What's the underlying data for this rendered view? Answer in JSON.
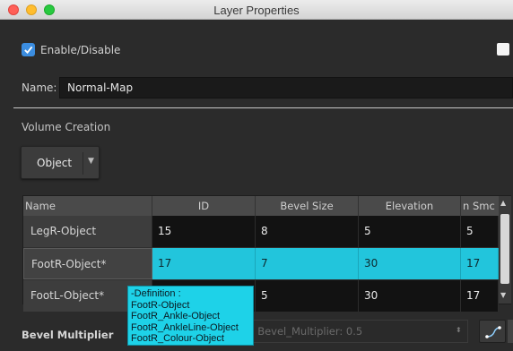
{
  "window": {
    "title": "Layer Properties"
  },
  "enable": {
    "label": "Enable/Disable",
    "checked": true
  },
  "name_field": {
    "label": "Name:",
    "value": "Normal-Map"
  },
  "volume": {
    "section_label": "Volume Creation",
    "dropdown_value": "Object"
  },
  "table": {
    "columns": [
      "Name",
      "ID",
      "Bevel Size",
      "Elevation",
      "n Smc"
    ],
    "rows": [
      {
        "name": "LegR-Object",
        "id": "15",
        "bevel": "8",
        "elevation": "5",
        "smooth": "5"
      },
      {
        "name": "FootR-Object*",
        "id": "17",
        "bevel": "7",
        "elevation": "30",
        "smooth": "17"
      },
      {
        "name": "FootL-Object*",
        "id": "",
        "bevel": "5",
        "elevation": "30",
        "smooth": "17"
      }
    ]
  },
  "tooltip": {
    "lines": [
      "-Definition :",
      "FootR-Object",
      "FootR_Ankle-Object",
      "FootR_AnkleLine-Object",
      "FootR_Colour-Object"
    ]
  },
  "bevel_multiplier": {
    "label": "Bevel Multiplier",
    "field_text": "al-Map: Bevel_Multiplier: 0.5"
  },
  "colors": {
    "selection": "#22c5dc",
    "checkbox": "#3b8de0",
    "tooltip_bg": "#1ed2e8"
  },
  "icons": [
    "checkmark-icon",
    "chevron-down-icon",
    "scroll-up-icon",
    "scroll-down-icon",
    "stepper-icon",
    "curve-icon"
  ]
}
